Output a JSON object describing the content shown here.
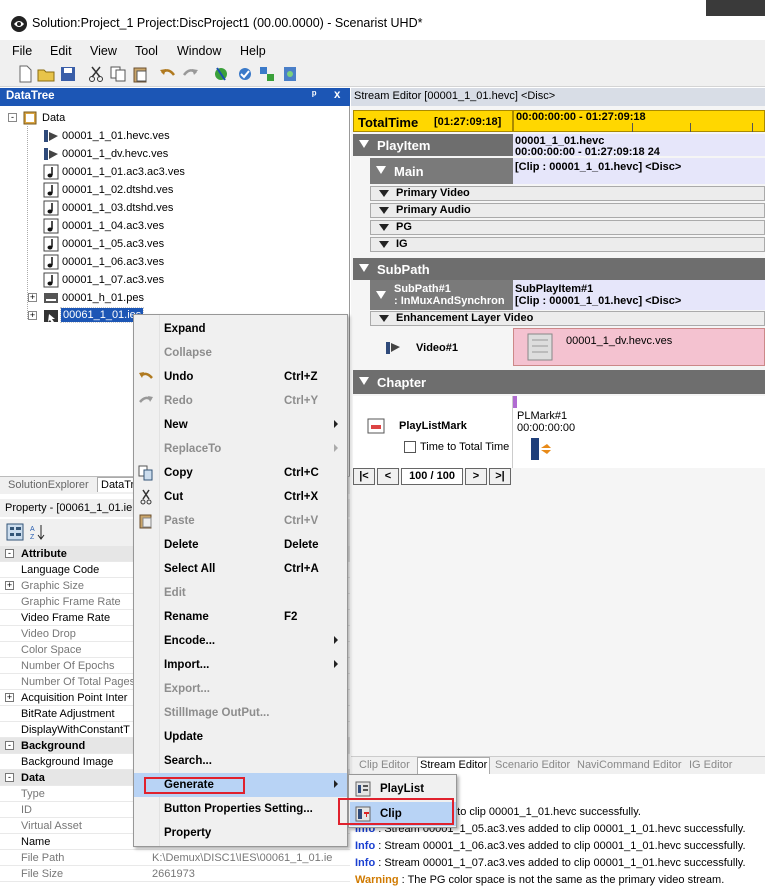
{
  "window": {
    "title": "Solution:Project_1  Project:DiscProject1 (00.00.0000) - Scenarist UHD*"
  },
  "menu": [
    {
      "label": "File"
    },
    {
      "label": "Edit"
    },
    {
      "label": "View"
    },
    {
      "label": "Tool"
    },
    {
      "label": "Window"
    },
    {
      "label": "Help"
    }
  ],
  "datatree": {
    "title": "DataTree",
    "pin": "ᵖ",
    "close": "x",
    "root": "Data",
    "items": [
      {
        "label": "00001_1_01.hevc.ves",
        "icon": "video-icon"
      },
      {
        "label": "00001_1_dv.hevc.ves",
        "icon": "video-icon"
      },
      {
        "label": "00001_1_01.ac3.ac3.ves",
        "icon": "audio-icon"
      },
      {
        "label": "00001_1_02.dtshd.ves",
        "icon": "audio-icon"
      },
      {
        "label": "00001_1_03.dtshd.ves",
        "icon": "audio-icon"
      },
      {
        "label": "00001_1_04.ac3.ves",
        "icon": "audio-icon"
      },
      {
        "label": "00001_1_05.ac3.ves",
        "icon": "audio-icon"
      },
      {
        "label": "00001_1_06.ac3.ves",
        "icon": "audio-icon"
      },
      {
        "label": "00001_1_07.ac3.ves",
        "icon": "audio-icon"
      },
      {
        "label": "00001_h_01.pes",
        "icon": "pes-icon"
      },
      {
        "label": "00061_1_01.ies",
        "icon": "ies-icon"
      }
    ]
  },
  "left_tabs": [
    {
      "label": "SolutionExplorer"
    },
    {
      "label": "DataTr"
    }
  ],
  "property": {
    "title": "Property - [00061_1_01.ie",
    "rows": [
      {
        "type": "cat",
        "label": "Attribute",
        "exp": "-"
      },
      {
        "label": "Language Code",
        "gray": false
      },
      {
        "label": "Graphic Size",
        "gray": true,
        "exp": "+"
      },
      {
        "label": "Graphic Frame Rate",
        "gray": true
      },
      {
        "label": "Video Frame Rate",
        "gray": false
      },
      {
        "label": "Video Drop",
        "gray": true
      },
      {
        "label": "Color Space",
        "gray": true
      },
      {
        "label": "Number Of Epochs",
        "gray": true
      },
      {
        "label": "Number Of Total Pages",
        "gray": true
      },
      {
        "label": "Acquisition Point Inter",
        "gray": false,
        "exp": "+"
      },
      {
        "label": "BitRate Adjustment",
        "gray": false
      },
      {
        "label": "DisplayWithConstantT",
        "gray": false
      },
      {
        "type": "cat",
        "label": "Background",
        "exp": "-"
      },
      {
        "label": "Background Image",
        "gray": false
      },
      {
        "type": "cat",
        "label": "Data",
        "exp": "-"
      },
      {
        "label": "Type",
        "gray": true
      },
      {
        "label": "ID",
        "gray": true
      },
      {
        "label": "Virtual Asset",
        "gray": true
      },
      {
        "label": "Name",
        "gray": false
      },
      {
        "label": "File Path",
        "gray": true,
        "value": "K:\\Demux\\DISC1\\IES\\00061_1_01.ie"
      },
      {
        "label": "File Size",
        "gray": true,
        "value": "2661973"
      }
    ]
  },
  "stream_editor": {
    "title": "Stream Editor [00001_1_01.hevc] <Disc>",
    "total_time_label": "TotalTime",
    "total_time": "[01:27:09:18]",
    "time_range": "00:00:00:00 - 01:27:09:18",
    "playitem_label": "PlayItem",
    "playitem_info1": "00001_1_01.hevc",
    "playitem_info2": "00:00:00:00 - 01:27:09:18  24",
    "main_label": "Main",
    "main_clip": "[Clip : 00001_1_01.hevc] <Disc>",
    "tracks": [
      {
        "label": "Primary Video"
      },
      {
        "label": "Primary Audio"
      },
      {
        "label": "PG"
      },
      {
        "label": "IG"
      }
    ],
    "subpath_label": "SubPath",
    "subpath1_line1": "SubPath#1",
    "subpath1_line2": ": InMuxAndSynchron",
    "subplayitem_line1": "SubPlayItem#1",
    "subplayitem_line2": "[Clip : 00001_1_01.hevc] <Disc>",
    "enh_layer": "Enhancement Layer Video",
    "video1": "Video#1",
    "dv_clip": "00001_1_dv.hevc.ves",
    "chapter_label": "Chapter",
    "playlistmark": "PlayListMark",
    "time_to_total": "Time to Total Time",
    "plmark": "PLMark#1",
    "plmark_time": "00:00:00:00",
    "nav": {
      "first": "|<",
      "prev": "<",
      "page": "100 / 100",
      "next": ">",
      "last": ">|"
    }
  },
  "bottom_tabs": [
    {
      "label": "Clip Editor",
      "active": false
    },
    {
      "label": "Stream Editor",
      "active": true
    },
    {
      "label": "Scenario Editor",
      "active": false
    },
    {
      "label": "NaviCommand Editor",
      "active": false
    },
    {
      "label": "IG Editor",
      "active": false
    }
  ],
  "output": [
    {
      "level": "",
      "text": "1_04.ac3.ves added to clip 00001_1_01.hevc successfully."
    },
    {
      "level": "Info",
      "text": " : Stream 00001_1_05.ac3.ves added to clip 00001_1_01.hevc successfully."
    },
    {
      "level": "Info",
      "text": " : Stream 00001_1_06.ac3.ves added to clip 00001_1_01.hevc successfully."
    },
    {
      "level": "Info",
      "text": " : Stream 00001_1_07.ac3.ves added to clip 00001_1_01.hevc successfully."
    },
    {
      "level": "Warning",
      "text": " : The PG color space is not the same as the primary video stream."
    }
  ],
  "context_menu": [
    {
      "label": "Expand",
      "shortcut": "",
      "disabled": false,
      "arrow": false,
      "icon": ""
    },
    {
      "label": "Collapse",
      "shortcut": "",
      "disabled": true,
      "arrow": false,
      "icon": ""
    },
    {
      "label": "Undo",
      "shortcut": "Ctrl+Z",
      "disabled": false,
      "arrow": false,
      "icon": "undo-icon"
    },
    {
      "label": "Redo",
      "shortcut": "Ctrl+Y",
      "disabled": true,
      "arrow": false,
      "icon": "redo-icon"
    },
    {
      "label": "New",
      "shortcut": "",
      "disabled": false,
      "arrow": true,
      "icon": ""
    },
    {
      "label": "ReplaceTo",
      "shortcut": "",
      "disabled": true,
      "arrow": true,
      "icon": ""
    },
    {
      "label": "Copy",
      "shortcut": "Ctrl+C",
      "disabled": false,
      "arrow": false,
      "icon": "copy-icon"
    },
    {
      "label": "Cut",
      "shortcut": "Ctrl+X",
      "disabled": false,
      "arrow": false,
      "icon": "cut-icon"
    },
    {
      "label": "Paste",
      "shortcut": "Ctrl+V",
      "disabled": true,
      "arrow": false,
      "icon": "paste-icon"
    },
    {
      "label": "Delete",
      "shortcut": "Delete",
      "disabled": false,
      "arrow": false,
      "icon": ""
    },
    {
      "label": "Select All",
      "shortcut": "Ctrl+A",
      "disabled": false,
      "arrow": false,
      "icon": ""
    },
    {
      "label": "Edit",
      "shortcut": "",
      "disabled": true,
      "arrow": false,
      "icon": ""
    },
    {
      "label": "Rename",
      "shortcut": "F2",
      "disabled": false,
      "arrow": false,
      "icon": ""
    },
    {
      "label": "Encode...",
      "shortcut": "",
      "disabled": false,
      "arrow": true,
      "icon": ""
    },
    {
      "label": "Import...",
      "shortcut": "",
      "disabled": false,
      "arrow": true,
      "icon": ""
    },
    {
      "label": "Export...",
      "shortcut": "",
      "disabled": true,
      "arrow": false,
      "icon": ""
    },
    {
      "label": "StillImage OutPut...",
      "shortcut": "",
      "disabled": true,
      "arrow": false,
      "icon": ""
    },
    {
      "label": "Update",
      "shortcut": "",
      "disabled": false,
      "arrow": false,
      "icon": ""
    },
    {
      "label": "Search...",
      "shortcut": "",
      "disabled": false,
      "arrow": false,
      "icon": ""
    },
    {
      "label": "Generate",
      "shortcut": "",
      "disabled": false,
      "arrow": true,
      "icon": "",
      "highlight": true
    },
    {
      "label": "Button Properties Setting...",
      "shortcut": "",
      "disabled": false,
      "arrow": false,
      "icon": ""
    },
    {
      "label": "Property",
      "shortcut": "",
      "disabled": false,
      "arrow": false,
      "icon": ""
    }
  ],
  "submenu": [
    {
      "label": "PlayList",
      "icon": "playlist-icon"
    },
    {
      "label": "Clip",
      "icon": "clip-icon",
      "highlight": true
    }
  ],
  "colors": {
    "title_blue": "#1c56b5",
    "total_time_yellow": "#ffd700",
    "dark_header": "#6e6e6e",
    "highlight_red": "#e0212d",
    "dv_pink": "#f4c2d0"
  }
}
